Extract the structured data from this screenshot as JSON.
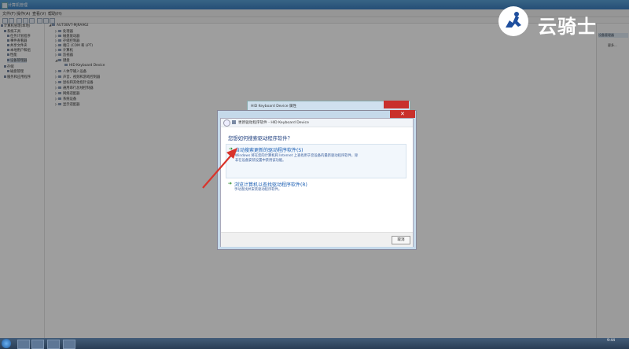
{
  "window": {
    "title": "计算机管理"
  },
  "menu": [
    "文件(F)",
    "操作(A)",
    "查看(V)",
    "帮助(H)"
  ],
  "left_tree": [
    "计算机管理(本地)",
    "系统工具",
    "任务计划程序",
    "事件查看器",
    "共享文件夹",
    "本地用户和组",
    "性能",
    "设备管理器",
    "存储",
    "磁盘管理",
    "服务和应用程序"
  ],
  "device_tree": {
    "root": "AUTOBVT-MJRA962",
    "items": [
      "处理器",
      "磁盘驱动器",
      "存储控制器",
      "端口 (COM 和 LPT)",
      "计算机",
      "监视器",
      "键盘"
    ],
    "keyboard_child": "HID Keyboard Device",
    "items_after": [
      "人体学输入设备",
      "声音、视频和游戏控制器",
      "鼠标和其他指针设备",
      "通用串行总线控制器",
      "网络适配器",
      "系统设备",
      "显示适配器"
    ]
  },
  "right_pane": {
    "header": "设备管理器",
    "more": "更多..."
  },
  "logo": {
    "text": "云骑士"
  },
  "back_dialog": {
    "title": "HID Keyboard Device 属性"
  },
  "dialog": {
    "nav_title": "更新驱动程序软件 - HID Keyboard Device",
    "question": "您想如何搜索驱动程序软件？",
    "option1": {
      "title": "自动搜索更新的驱动程序软件(S)",
      "desc_line1": "Windows 将在您的计算机和 Internet 上查找用于您设备的最新驱动程序软件，除",
      "desc_line2": "非在设备安装设置中禁用该功能。"
    },
    "option2": {
      "title": "浏览计算机以查找驱动程序软件(R)",
      "desc": "手动查找并安装驱动程序软件。"
    },
    "cancel": "取消"
  },
  "taskbar": {
    "time": "9:44"
  },
  "colors": {
    "accent_red": "#d9342b",
    "link_blue": "#1c5fb3"
  }
}
